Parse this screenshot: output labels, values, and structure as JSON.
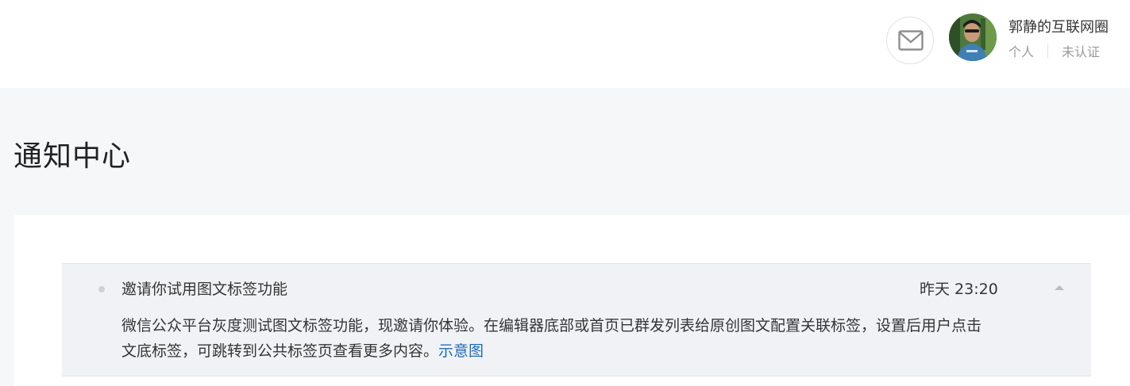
{
  "header": {
    "account_name": "郭静的互联网圈",
    "account_type": "个人",
    "verification": "未认证",
    "icons": {
      "mail": "mail-icon",
      "avatar": "avatar-photo"
    }
  },
  "page": {
    "title": "通知中心"
  },
  "notices": [
    {
      "title": "邀请你试用图文标签功能",
      "time": "昨天 23:20",
      "body": "微信公众平台灰度测试图文标签功能，现邀请你体验。在编辑器底部或首页已群发列表给原创图文配置关联标签，设置后用户点击文底标签，可跳转到公共标签页查看更多内容。",
      "link_text": "示意图"
    }
  ],
  "colors": {
    "accent_link": "#1e6bb8",
    "page_bg": "#f6f7f9",
    "notice_bg": "#f1f2f5"
  }
}
